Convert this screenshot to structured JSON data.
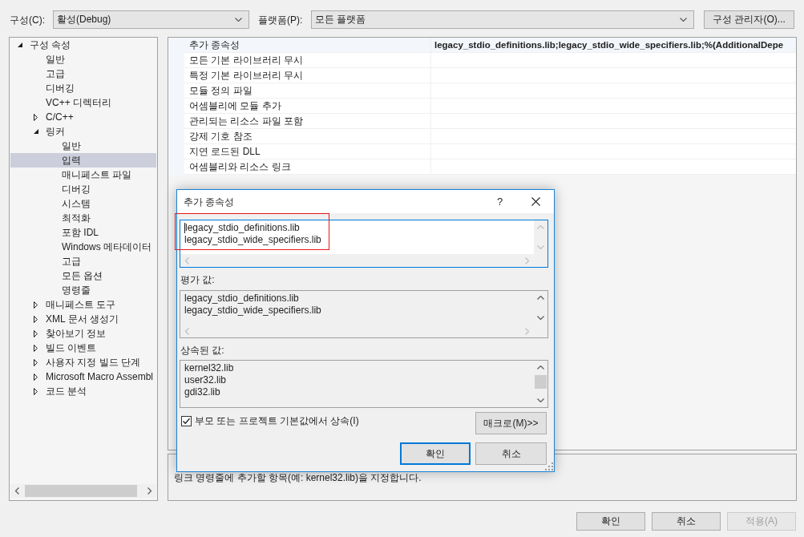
{
  "toolbar": {
    "configuration": {
      "label": "구성(C):",
      "value": "활성(Debug)"
    },
    "platform": {
      "label": "플랫폼(P):",
      "value": "모든 플랫폼"
    },
    "manager_button": "구성 관리자(O)..."
  },
  "tree": [
    {
      "label": "구성 속성",
      "expanded": true,
      "selected": false,
      "children": [
        {
          "label": "일반",
          "selected": false
        },
        {
          "label": "고급",
          "selected": false
        },
        {
          "label": "디버깅",
          "selected": false
        },
        {
          "label": "VC++ 디렉터리",
          "selected": false
        },
        {
          "label": "C/C++",
          "expanded": false,
          "selected": false
        },
        {
          "label": "링커",
          "expanded": true,
          "selected": false,
          "children": [
            {
              "label": "일반",
              "selected": false
            },
            {
              "label": "입력",
              "selected": true
            },
            {
              "label": "매니페스트 파일",
              "selected": false
            },
            {
              "label": "디버깅",
              "selected": false
            },
            {
              "label": "시스템",
              "selected": false
            },
            {
              "label": "최적화",
              "selected": false
            },
            {
              "label": "포함 IDL",
              "selected": false
            },
            {
              "label": "Windows 메타데이터",
              "selected": false
            },
            {
              "label": "고급",
              "selected": false
            },
            {
              "label": "모든 옵션",
              "selected": false
            },
            {
              "label": "명령줄",
              "selected": false
            }
          ]
        },
        {
          "label": "매니페스트 도구",
          "expanded": false,
          "selected": false
        },
        {
          "label": "XML 문서 생성기",
          "expanded": false,
          "selected": false
        },
        {
          "label": "찾아보기 정보",
          "expanded": false,
          "selected": false
        },
        {
          "label": "빌드 이벤트",
          "expanded": false,
          "selected": false
        },
        {
          "label": "사용자 지정 빌드 단계",
          "expanded": false,
          "selected": false
        },
        {
          "label": "Microsoft Macro Assembl",
          "expanded": false,
          "selected": false
        },
        {
          "label": "코드 분석",
          "expanded": false,
          "selected": false
        }
      ]
    }
  ],
  "property_grid": {
    "rows": [
      {
        "name": "추가 종속성",
        "value": "legacy_stdio_definitions.lib;legacy_stdio_wide_specifiers.lib;%(AdditionalDepe",
        "inherited": false,
        "selected": true
      },
      {
        "name": "모든 기본 라이브러리 무시",
        "selected": false
      },
      {
        "name": "특정 기본 라이브러리 무시",
        "selected": false
      },
      {
        "name": "모듈 정의 파일",
        "selected": false
      },
      {
        "name": "어셈블리에 모듈 추가",
        "selected": false
      },
      {
        "name": "관리되는 리소스 파일 포함",
        "selected": false
      },
      {
        "name": "강제 기호 참조",
        "selected": false
      },
      {
        "name": "지연 로드된 DLL",
        "selected": false
      },
      {
        "name": "어셈블리와 리소스 링크",
        "selected": false
      }
    ]
  },
  "description": {
    "text": "링크 명령줄에 추가할 항목(예: kernel32.lib)을 지정합니다."
  },
  "buttons": [
    {
      "label": "확인",
      "disabled": false
    },
    {
      "label": "취소",
      "disabled": false
    },
    {
      "label": "적용(A)",
      "disabled": true
    }
  ],
  "dialog": {
    "title": "추가 종속성",
    "help": "?",
    "edit": {
      "lines": [
        "legacy_stdio_definitions.lib",
        "legacy_stdio_wide_specifiers.lib"
      ],
      "focused": true,
      "highlighted": true
    },
    "evaluated": {
      "label": "평가 값:",
      "lines": [
        "legacy_stdio_definitions.lib",
        "legacy_stdio_wide_specifiers.lib"
      ]
    },
    "inherited": {
      "label": "상속된 값:",
      "lines": [
        "kernel32.lib",
        "user32.lib",
        "gdi32.lib"
      ]
    },
    "inherit_option": {
      "label": "부모 또는 프로젝트 기본값에서 상속(I)",
      "checked": true
    },
    "macro_button": "매크로(M)>>",
    "buttons": [
      {
        "label": "확인",
        "default": true
      },
      {
        "label": "취소",
        "default": false
      }
    ]
  }
}
